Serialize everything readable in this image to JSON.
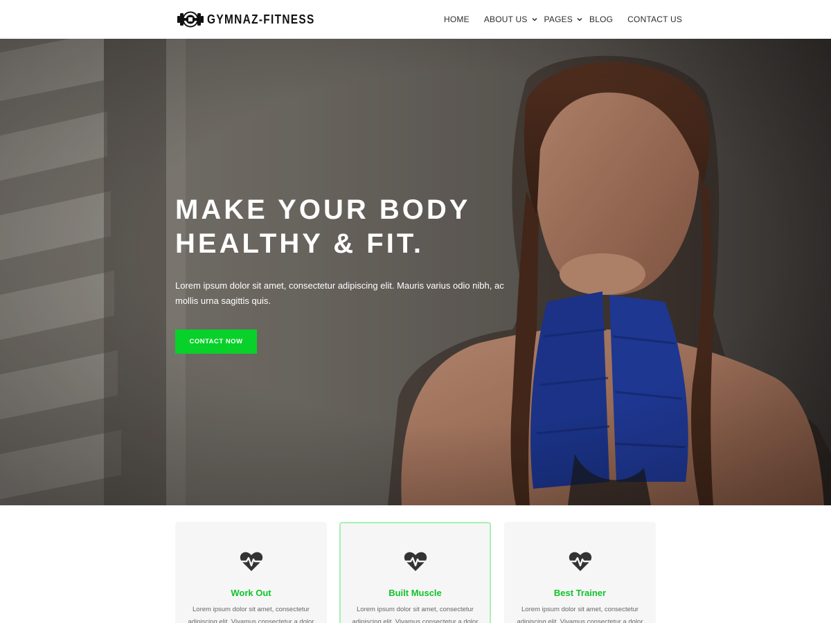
{
  "brand": {
    "name": "GYMNAZ-FITNESS",
    "logo_icon": "dumbbell-icon"
  },
  "nav": {
    "home": "HOME",
    "about": "ABOUT US",
    "pages": "PAGES",
    "blog": "BLOG",
    "contact": "CONTACT US",
    "dropdown_icon": "chevron-down-icon"
  },
  "hero": {
    "title_line1": "MAKE YOUR BODY",
    "title_line2": "HEALTHY & FIT.",
    "text": "Lorem ipsum dolor sit amet, consectetur adipiscing elit. Mauris varius odio nibh, ac mollis urna sagittis quis.",
    "button": "CONTACT NOW"
  },
  "features": [
    {
      "icon": "heartbeat-icon",
      "title": "Work Out",
      "text": "Lorem ipsum dolor sit amet, consectetur adipiscing elit. Vivamus consectetur a dolor at"
    },
    {
      "icon": "heartbeat-icon",
      "title": "Built Muscle",
      "text": "Lorem ipsum dolor sit amet, consectetur adipiscing elit. Vivamus consectetur a dolor at"
    },
    {
      "icon": "heartbeat-icon",
      "title": "Best Trainer",
      "text": "Lorem ipsum dolor sit amet, consectetur adipiscing elit. Vivamus consectetur a dolor at"
    }
  ],
  "colors": {
    "accent": "#08d12a",
    "feature_title": "#10c32a",
    "wrap_blue": "#1f3a9a",
    "card_bg": "#f6f6f6",
    "active_card_border": "#a7f0b4"
  }
}
